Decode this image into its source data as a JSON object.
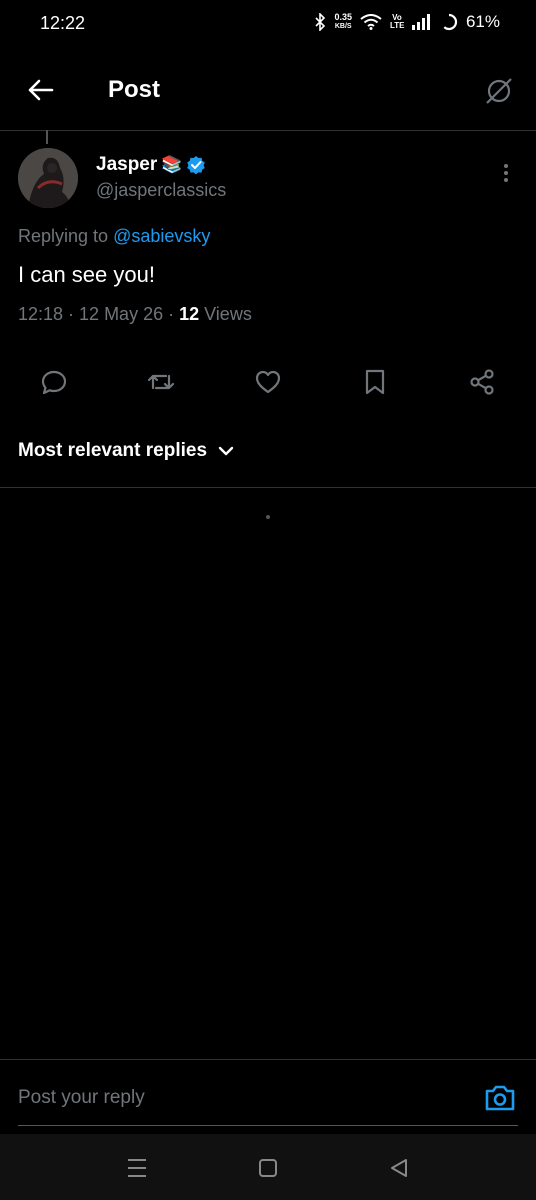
{
  "status": {
    "time": "12:22",
    "net_speed": "0.35",
    "net_unit": "KB/S",
    "volte": "Vo LTE",
    "battery": "61%"
  },
  "header": {
    "title": "Post"
  },
  "post": {
    "display_name": "Jasper",
    "emoji": "📚",
    "handle": "@jasperclassics",
    "replying_prefix": "Replying to ",
    "replying_to": "@sabievsky",
    "text": "I can see you!",
    "time_date": "12:18 · 12 May 26 · ",
    "views_count": "12",
    "views_label": " Views"
  },
  "sort": {
    "label": "Most relevant replies"
  },
  "reply": {
    "placeholder": "Post your reply"
  },
  "colors": {
    "accent": "#1d9bf0",
    "background": "#000000",
    "secondary_text": "#71767b"
  }
}
